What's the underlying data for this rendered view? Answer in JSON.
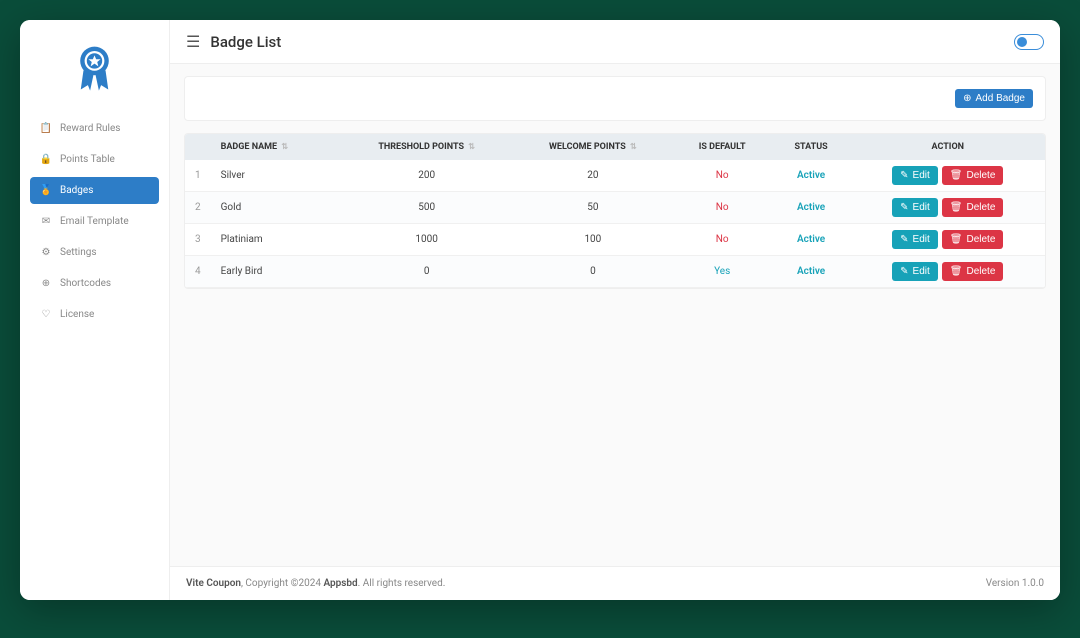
{
  "header": {
    "page_title": "Badge List"
  },
  "sidebar": {
    "items": [
      {
        "label": "Reward Rules",
        "icon": "📋"
      },
      {
        "label": "Points Table",
        "icon": "🔒"
      },
      {
        "label": "Badges",
        "icon": "🏅",
        "active": true
      },
      {
        "label": "Email Template",
        "icon": "✉"
      },
      {
        "label": "Settings",
        "icon": "⚙"
      },
      {
        "label": "Shortcodes",
        "icon": "⊕"
      },
      {
        "label": "License",
        "icon": "♡"
      }
    ]
  },
  "toolbar": {
    "add_label": "Add Badge"
  },
  "table": {
    "columns": {
      "badge_name": "BADGE NAME",
      "threshold_points": "THRESHOLD POINTS",
      "welcome_points": "WELCOME POINTS",
      "is_default": "IS DEFAULT",
      "status": "STATUS",
      "action": "ACTION"
    },
    "rows": [
      {
        "idx": "1",
        "name": "Silver",
        "threshold": "200",
        "welcome": "20",
        "is_default": "No",
        "status": "Active"
      },
      {
        "idx": "2",
        "name": "Gold",
        "threshold": "500",
        "welcome": "50",
        "is_default": "No",
        "status": "Active"
      },
      {
        "idx": "3",
        "name": "Platiniam",
        "threshold": "1000",
        "welcome": "100",
        "is_default": "No",
        "status": "Active"
      },
      {
        "idx": "4",
        "name": "Early Bird",
        "threshold": "0",
        "welcome": "0",
        "is_default": "Yes",
        "status": "Active"
      }
    ],
    "action_labels": {
      "edit": "Edit",
      "delete": "Delete"
    }
  },
  "footer": {
    "product": "Vite Coupon",
    "copyright": ", Copyright ©2024 ",
    "company": "Appsbd",
    "rights": ". All rights reserved.",
    "version_label": "Version ",
    "version": "1.0.0"
  }
}
